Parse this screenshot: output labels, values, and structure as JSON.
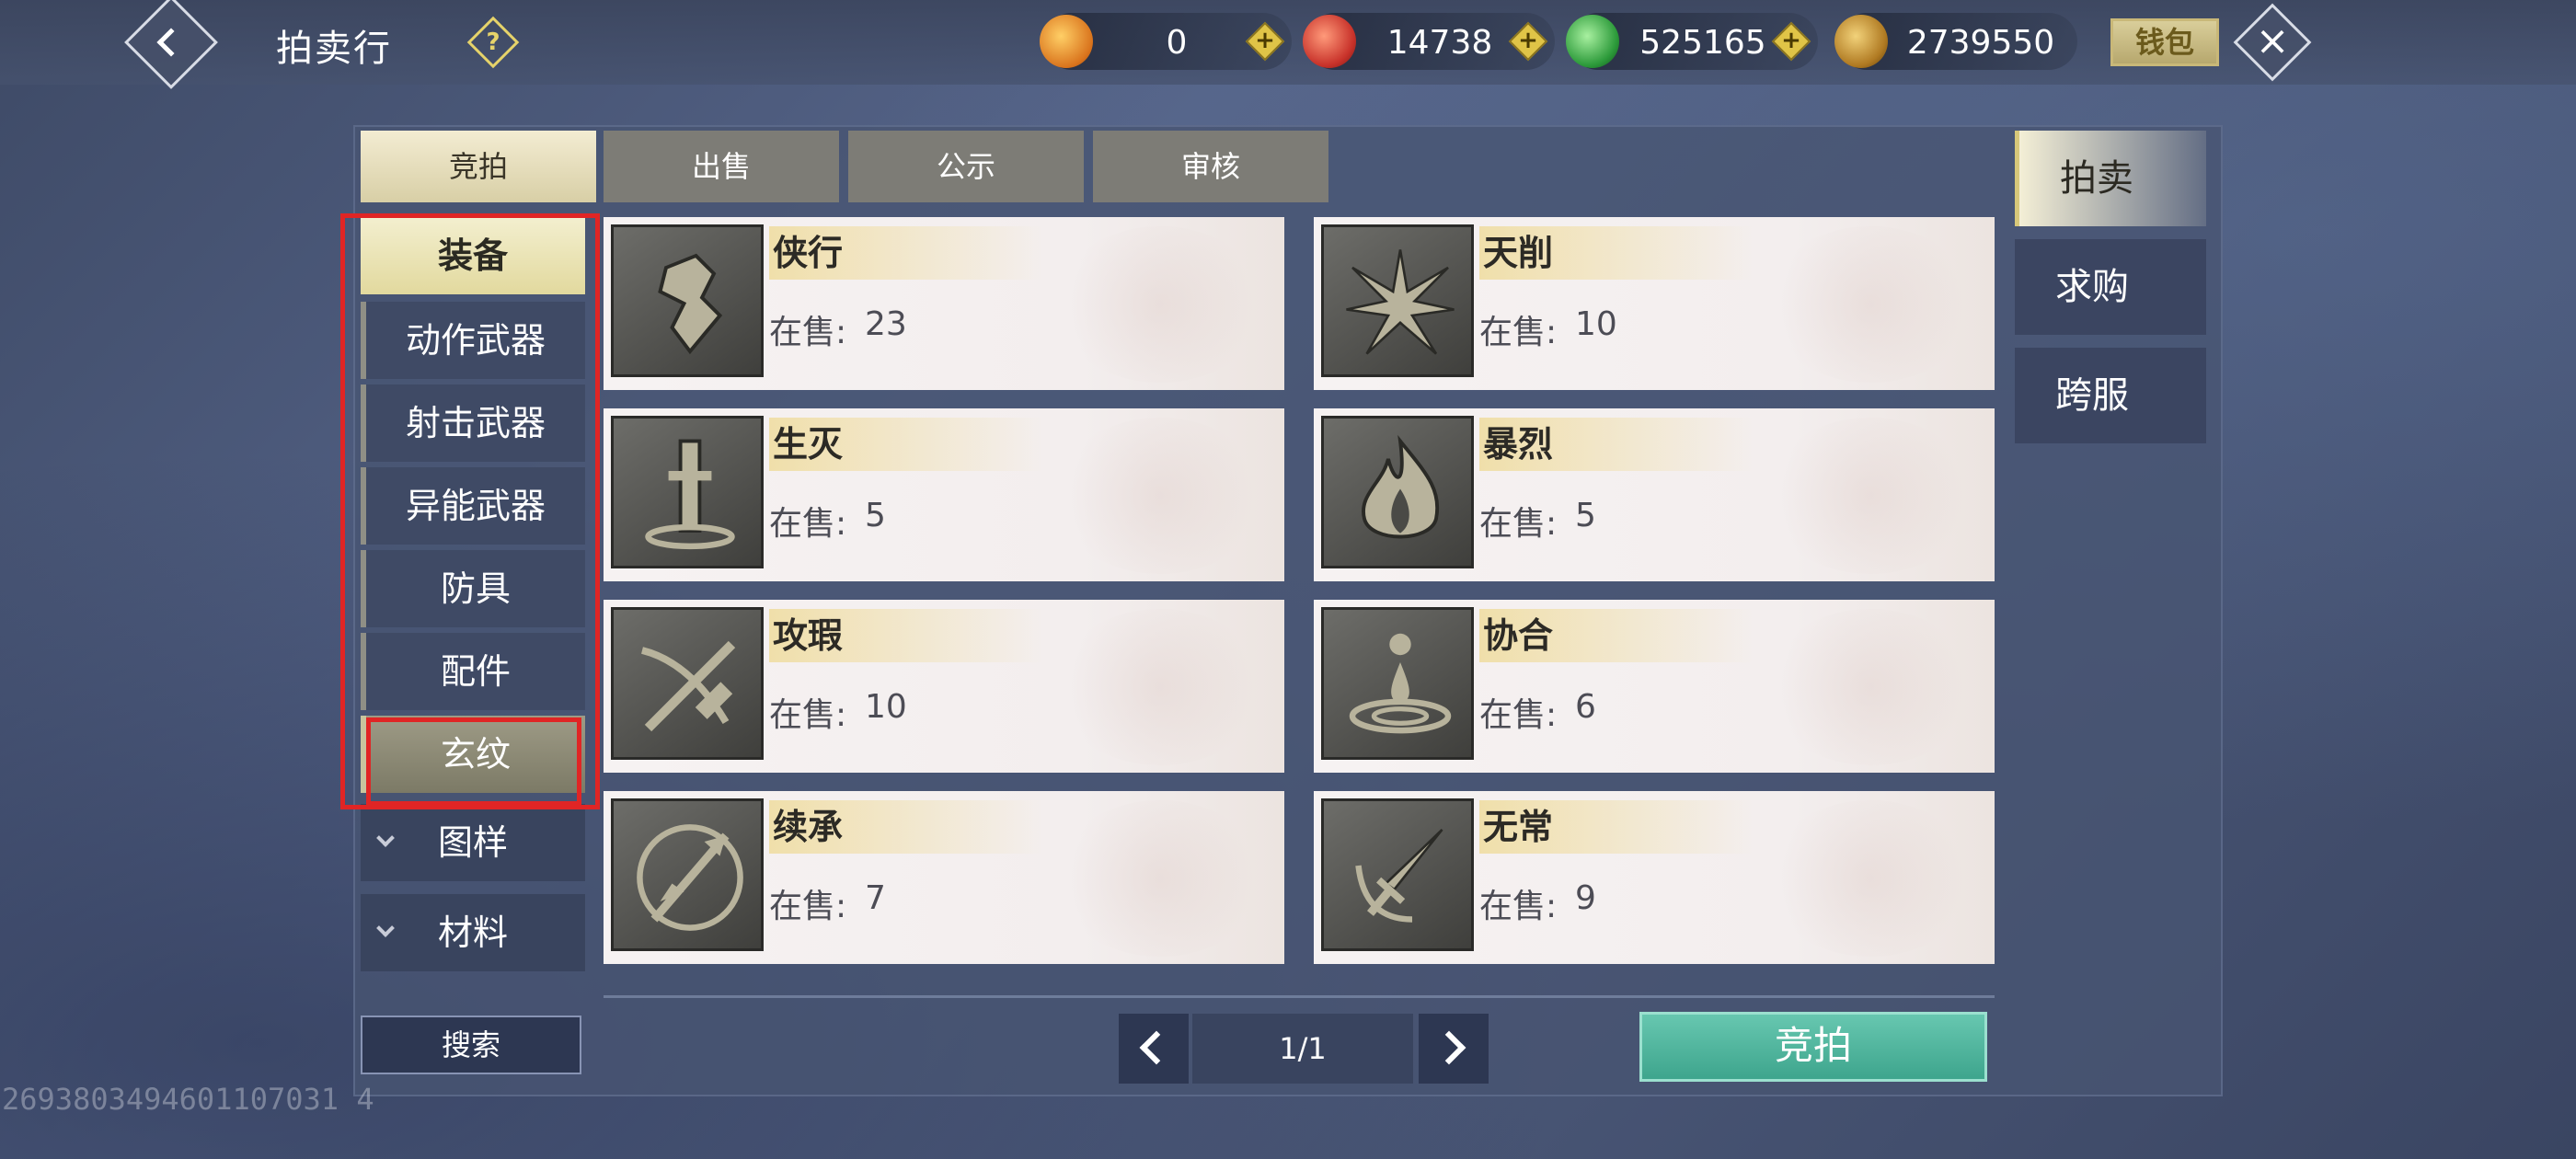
{
  "header": {
    "title": "拍卖行",
    "wallet_label": "钱包",
    "currencies": [
      {
        "icon": "orange-flame-coin-icon",
        "amount": "0"
      },
      {
        "icon": "red-swirl-coin-icon",
        "amount": "14738"
      },
      {
        "icon": "green-jade-coin-icon",
        "amount": "525165"
      },
      {
        "icon": "gold-leaf-coin-icon",
        "amount": "2739550"
      }
    ]
  },
  "tabs": [
    "竞拍",
    "出售",
    "公示",
    "审核"
  ],
  "categories": {
    "main": "装备",
    "subs": [
      "动作武器",
      "射击武器",
      "异能武器",
      "防具",
      "配件",
      "玄纹"
    ],
    "collapsed": [
      "图样",
      "材料"
    ]
  },
  "stock_label": "在售:",
  "items": [
    {
      "name": "侠行",
      "stock": "23",
      "icon": "hand-emblem-icon"
    },
    {
      "name": "天削",
      "stock": "10",
      "icon": "star-burst-icon"
    },
    {
      "name": "生灭",
      "stock": "5",
      "icon": "pillar-icon"
    },
    {
      "name": "暴烈",
      "stock": "5",
      "icon": "flame-icon"
    },
    {
      "name": "攻瑕",
      "stock": "10",
      "icon": "crossbow-icon"
    },
    {
      "name": "协合",
      "stock": "6",
      "icon": "water-drop-icon"
    },
    {
      "name": "续承",
      "stock": "7",
      "icon": "arrow-shield-icon"
    },
    {
      "name": "无常",
      "stock": "9",
      "icon": "dagger-icon"
    }
  ],
  "footer": {
    "search_label": "搜索",
    "page": "1/1",
    "bid_label": "竞拍"
  },
  "side_tabs": [
    "拍卖",
    "求购",
    "跨服"
  ],
  "watermark": "2693803494601107031 4"
}
